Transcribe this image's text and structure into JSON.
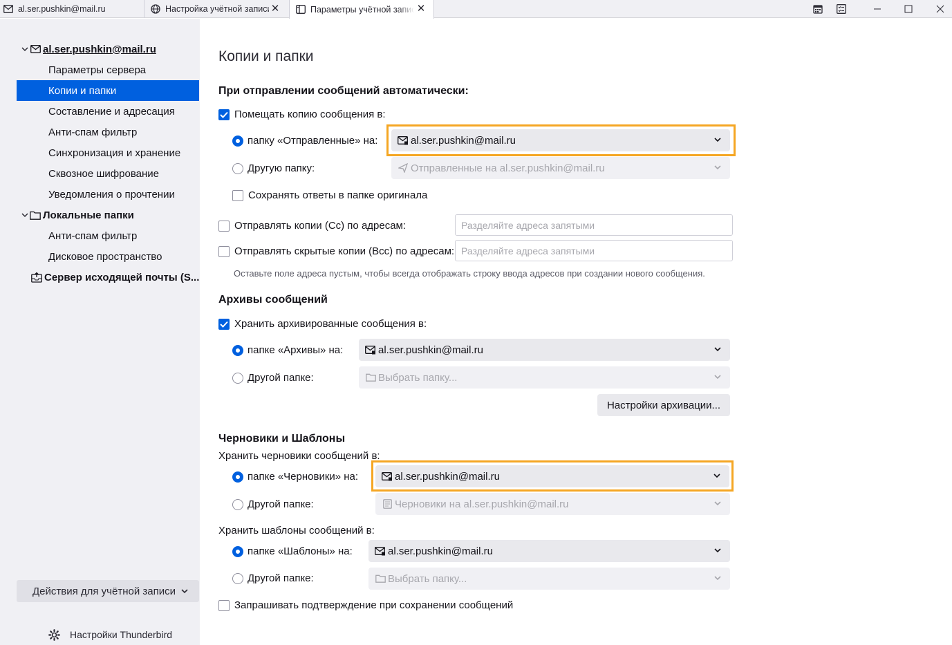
{
  "tabs": [
    {
      "label": "al.ser.pushkin@mail.ru",
      "icon": "mail-icon"
    },
    {
      "label": "Настройка учётной записи",
      "icon": "globe-icon"
    },
    {
      "label": "Параметры учётной записи",
      "icon": "settings-panel-icon"
    }
  ],
  "window_controls": [
    "calendar-icon",
    "tasks-icon",
    "minimize-icon",
    "maximize-icon",
    "close-icon"
  ],
  "sidebar": {
    "account": "al.ser.pushkin@mail.ru",
    "account_items": [
      "Параметры сервера",
      "Копии и папки",
      "Составление и адресация",
      "Анти-спам фильтр",
      "Синхронизация и хранение",
      "Сквозное шифрование",
      "Уведомления о прочтении"
    ],
    "selected_item": "Копии и папки",
    "local": "Локальные папки",
    "local_items": [
      "Анти-спам фильтр",
      "Дисковое пространство"
    ],
    "smtp": "Сервер исходящей почты (S...",
    "actions": "Действия для учётной записи",
    "tb_settings": "Настройки Thunderbird"
  },
  "main": {
    "title": "Копии и папки",
    "send": {
      "heading": "При отправлении сообщений автоматически:",
      "place_copy": "Помещать копию сообщения в:",
      "sent_folder_on": "папку «Отправленные» на:",
      "sent_account": "al.ser.pushkin@mail.ru",
      "other_folder": "Другую папку:",
      "other_folder_value": "Отправленные на al.ser.pushkin@mail.ru",
      "save_replies": "Сохранять ответы в папке оригинала",
      "cc_label": "Отправлять копии (Cc) по адресам:",
      "cc_placeholder": "Разделяйте адреса запятыми",
      "bcc_label": "Отправлять скрытые копии (Bcc) по адресам:",
      "bcc_placeholder": "Разделяйте адреса запятыми",
      "hint": "Оставьте поле адреса пустым, чтобы всегда отображать строку ввода адресов при создании нового сообщения."
    },
    "archive": {
      "heading": "Архивы сообщений",
      "keep": "Хранить архивированные сообщения в:",
      "folder_on": "папке «Архивы» на:",
      "account": "al.ser.pushkin@mail.ru",
      "other": "Другой папке:",
      "other_value": "Выбрать папку...",
      "settings_button": "Настройки архивации..."
    },
    "drafts": {
      "heading": "Черновики и Шаблоны",
      "keep_drafts": "Хранить черновики сообщений в:",
      "drafts_on": "папке «Черновики» на:",
      "drafts_account": "al.ser.pushkin@mail.ru",
      "other": "Другой папке:",
      "other_value": "Черновики на al.ser.pushkin@mail.ru",
      "keep_templates": "Хранить шаблоны сообщений в:",
      "templates_on": "папке «Шаблоны» на:",
      "templates_account": "al.ser.pushkin@mail.ru",
      "other2": "Другой папке:",
      "other2_value": "Выбрать папку...",
      "confirm": "Запрашивать подтверждение при сохранении сообщений"
    }
  },
  "colors": {
    "accent": "#0060df",
    "highlight": "#f5a623"
  },
  "state": {
    "place_copy_checked": true,
    "save_replies_checked": false,
    "cc_checked": false,
    "bcc_checked": false,
    "archive_checked": true,
    "confirm_checked": false
  }
}
